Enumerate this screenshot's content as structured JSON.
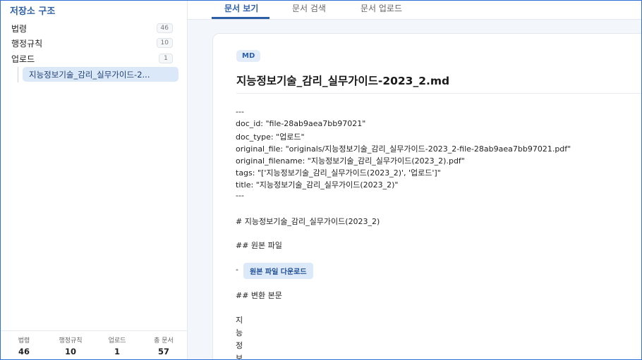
{
  "sidebar": {
    "title": "저장소 구조",
    "folders": [
      {
        "label": "법령",
        "count": "46"
      },
      {
        "label": "행정규칙",
        "count": "10"
      },
      {
        "label": "업로드",
        "count": "1"
      }
    ],
    "selected_file": "지능정보기술_감리_실무가이드-2...",
    "stats": [
      {
        "label": "법령",
        "value": "46"
      },
      {
        "label": "행정규칙",
        "value": "10"
      },
      {
        "label": "업로드",
        "value": "1"
      },
      {
        "label": "총 문서",
        "value": "57"
      }
    ]
  },
  "tabs": [
    {
      "label": "문서 보기",
      "active": true
    },
    {
      "label": "문서 검색",
      "active": false
    },
    {
      "label": "문서 업로드",
      "active": false
    }
  ],
  "document": {
    "format_badge": "MD",
    "title": "지능정보기술_감리_실무가이드-2023_2.md",
    "frontmatter_open": "---",
    "doc_id": "doc_id: \"file-28ab9aea7bb97021\"",
    "doc_type": "doc_type: \"업로드\"",
    "original_file": "original_file: \"originals/지능정보기술_감리_실무가이드-2023_2-file-28ab9aea7bb97021.pdf\"",
    "original_filename": "original_filename: \"지능정보기술_감리_실무가이드(2023_2).pdf\"",
    "tags": "tags: \"['지능정보기술_감리_실무가이드(2023_2)', '업로드']\"",
    "title_line": "title: \"지능정보기술_감리_실무가이드(2023_2)\"",
    "frontmatter_close": "---",
    "h1": "# 지능정보기술_감리_실무가이드(2023_2)",
    "h2_original": "## 원본 파일",
    "list_dash": "-",
    "download_label": "원본 파일 다운로드",
    "h2_converted": "## 변환 본문",
    "body_chars": [
      "지",
      "능",
      "정",
      "보"
    ]
  }
}
